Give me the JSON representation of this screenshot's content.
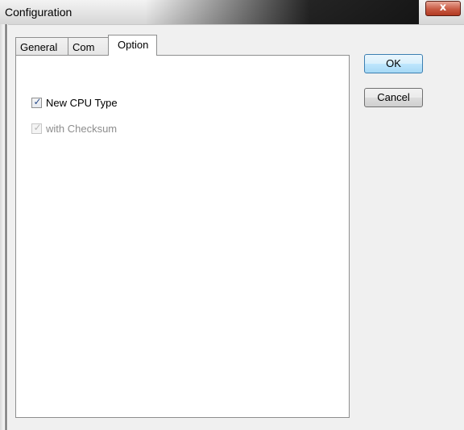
{
  "window": {
    "title": "Configuration",
    "close_glyph": "x"
  },
  "tabs": [
    {
      "label": "General",
      "active": false
    },
    {
      "label": "Com",
      "active": false
    },
    {
      "label": "Option",
      "active": true
    }
  ],
  "options": {
    "new_cpu_type": {
      "label": "New CPU Type",
      "checked": true,
      "enabled": true
    },
    "with_checksum": {
      "label": "with Checksum",
      "checked": true,
      "enabled": false
    },
    "check_glyph": "✓"
  },
  "buttons": {
    "ok": "OK",
    "cancel": "Cancel"
  },
  "colors": {
    "close_button": "#c85a43",
    "default_button": "#bee6fd"
  }
}
